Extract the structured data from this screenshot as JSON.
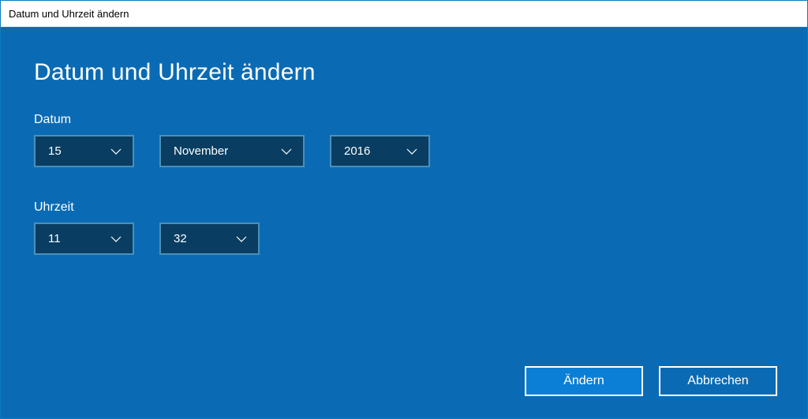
{
  "window": {
    "title": "Datum und Uhrzeit ändern"
  },
  "heading": "Datum und Uhrzeit ändern",
  "date": {
    "label": "Datum",
    "day": "15",
    "month": "November",
    "year": "2016"
  },
  "time": {
    "label": "Uhrzeit",
    "hour": "11",
    "minute": "32"
  },
  "buttons": {
    "confirm": "Ändern",
    "cancel": "Abbrechen"
  }
}
